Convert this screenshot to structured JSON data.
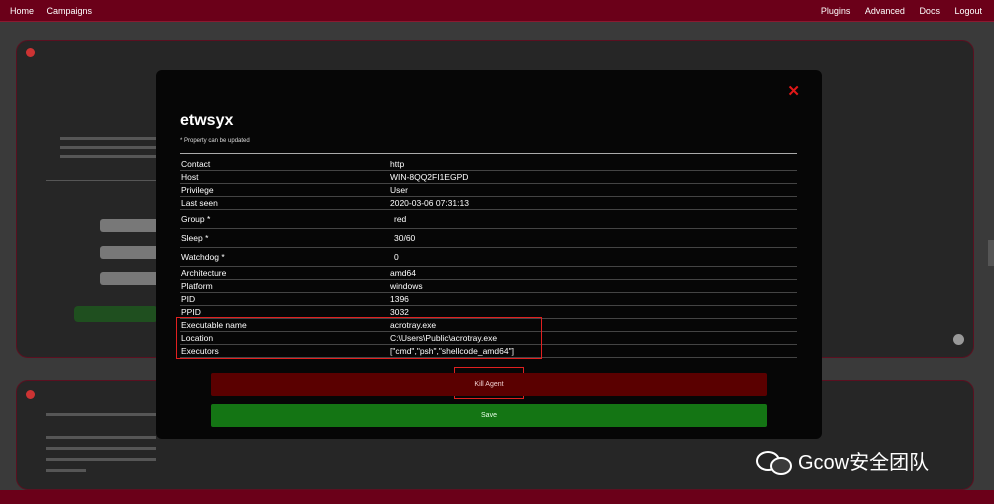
{
  "nav": {
    "left": [
      "Home",
      "Campaigns"
    ],
    "right": [
      "Plugins",
      "Advanced",
      "Docs",
      "Logout"
    ]
  },
  "modal": {
    "close_glyph": "✕",
    "title": "etwsyx",
    "note": "* Property can be updated",
    "properties": [
      {
        "key": "Contact",
        "value": "http",
        "editable": false
      },
      {
        "key": "Host",
        "value": "WIN-8QQ2FI1EGPD",
        "editable": false
      },
      {
        "key": "Privilege",
        "value": "User",
        "editable": false
      },
      {
        "key": "Last seen",
        "value": "2020-03-06 07:31:13",
        "editable": false
      },
      {
        "key": "Group *",
        "value": "red",
        "editable": true
      },
      {
        "key": "Sleep *",
        "value": "30/60",
        "editable": true
      },
      {
        "key": "Watchdog *",
        "value": "0",
        "editable": true
      },
      {
        "key": "Architecture",
        "value": "amd64",
        "editable": false
      },
      {
        "key": "Platform",
        "value": "windows",
        "editable": false
      },
      {
        "key": "PID",
        "value": "1396",
        "editable": false
      },
      {
        "key": "PPID",
        "value": "3032",
        "editable": false
      },
      {
        "key": "Executable name",
        "value": "acrotray.exe",
        "editable": false
      },
      {
        "key": "Location",
        "value": "C:\\Users\\Public\\acrotray.exe",
        "editable": false
      },
      {
        "key": "Executors",
        "value": "[\"cmd\",\"psh\",\"shellcode_amd64\"]",
        "editable": false
      }
    ],
    "kill_label": "Kill Agent",
    "save_label": "Save"
  },
  "watermark": "Gcow安全团队",
  "colors": {
    "nav": "#6b0019",
    "close": "#e01818",
    "kill": "#5a0000",
    "save": "#147514",
    "highlight": "#e02020"
  }
}
